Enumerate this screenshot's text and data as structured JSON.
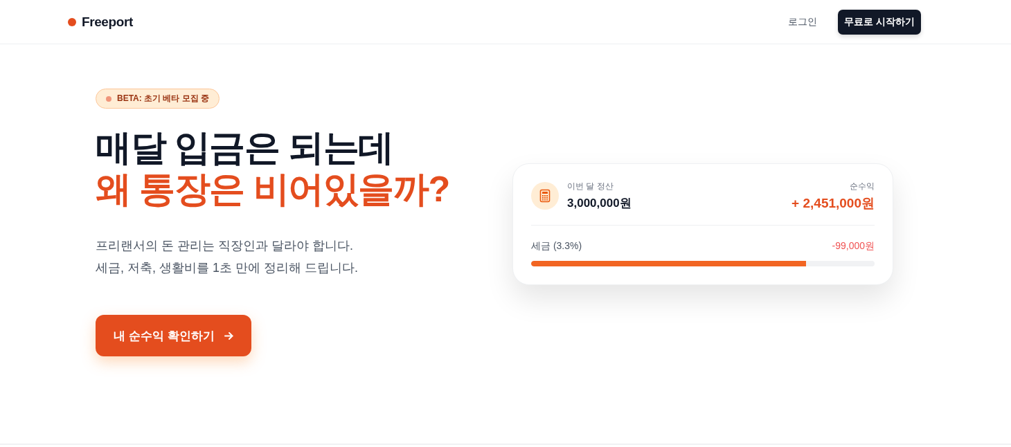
{
  "header": {
    "logo": "Freeport",
    "login": "로그인",
    "cta": "무료로 시작하기"
  },
  "hero": {
    "badge": "BETA: 초기 베타 모집 중",
    "headline": [
      {
        "text": "매달 입금은 되는데",
        "highlight": false
      },
      {
        "text": "왜 통장은 비어있을까?",
        "highlight": true
      }
    ],
    "subtitle": [
      "프리랜서의 돈 관리는 직장인과 달라야 합니다.",
      "세금, 저축, 생활비를 1초 만에 정리해 드립니다."
    ],
    "cta": "내 순수익 확인하기"
  },
  "card": {
    "label": "이번 달 정산",
    "amount": "3,000,000원",
    "net_label": "순수익",
    "net_amount": "+ 2,451,000원",
    "tax_label": "세금 (3.3%)",
    "tax_amount": "-99,000원",
    "tax_bar": {
      "level": 0.8
    }
  }
}
